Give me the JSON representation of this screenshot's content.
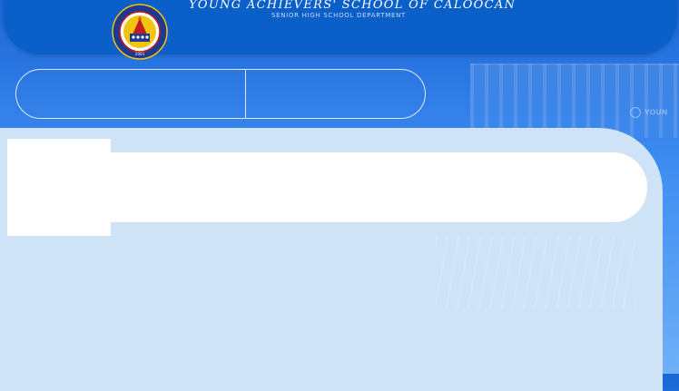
{
  "header": {
    "school_name": "YOUNG ACHIEVERS' SCHOOL OF CALOOCAN",
    "department": "SENIOR HIGH SCHOOL DEPARTMENT",
    "logo_icon": "school-seal-icon",
    "logo_year": "2003"
  },
  "background": {
    "watermark_text": "YOUN"
  },
  "nav": {
    "items": [
      {
        "label": ""
      },
      {
        "label": ""
      }
    ]
  },
  "colors": {
    "header_blue": "#0a5fc8",
    "panel": "#cfe3f7",
    "seal_ring": "#1d3a8f",
    "seal_gold": "#f2c40f"
  }
}
